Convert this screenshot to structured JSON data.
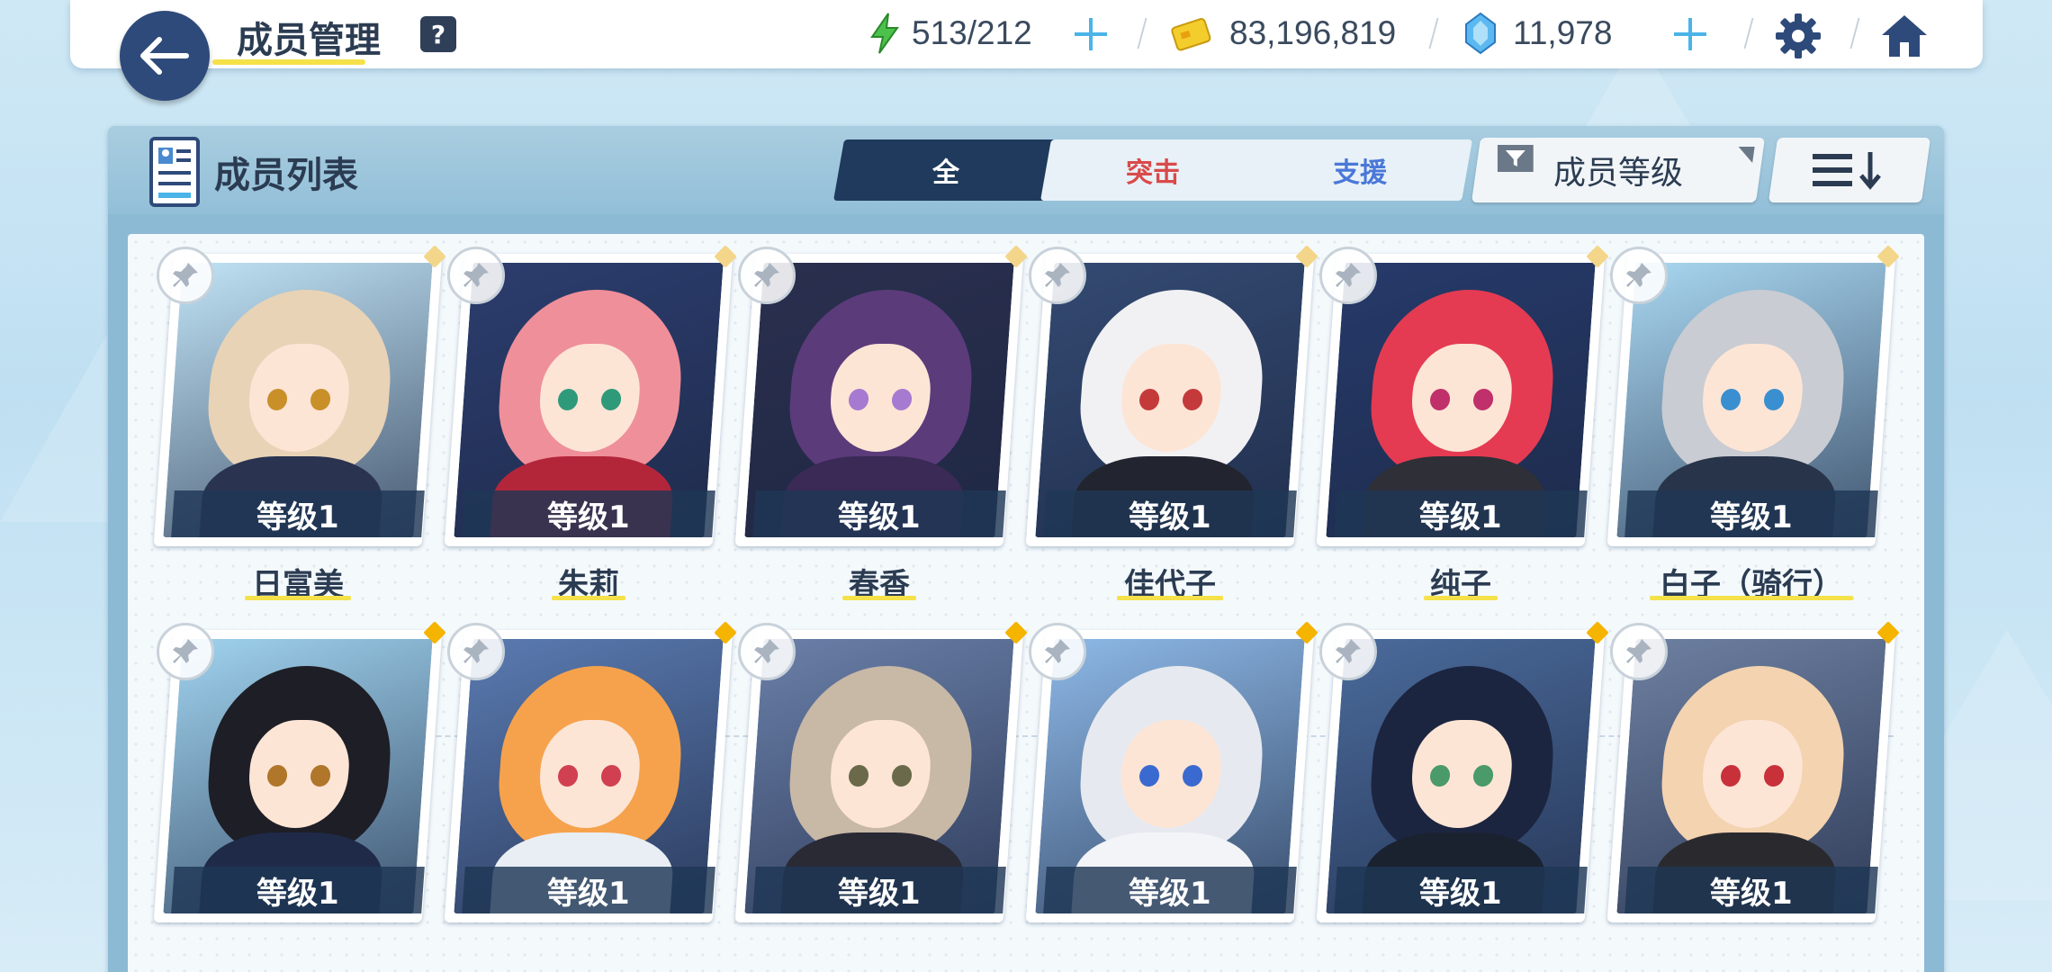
{
  "header": {
    "title": "成员管理",
    "help_label": "?",
    "stamina": "513/212",
    "credits": "83,196,819",
    "gems": "11,978"
  },
  "panel": {
    "title": "成员列表",
    "tabs": [
      {
        "label": "全",
        "active": true,
        "color": "#ffffff"
      },
      {
        "label": "突击",
        "active": false,
        "color": "#d94a4a"
      },
      {
        "label": "支援",
        "active": false,
        "color": "#4a78d8"
      }
    ],
    "sort_label": "成员等级"
  },
  "members": [
    {
      "name": "日富美",
      "level": "等级1",
      "hair": "#e8d3b6",
      "eye": "#c9902a",
      "bg": "#bfe2f4",
      "outfit": "#2a3350"
    },
    {
      "name": "朱莉",
      "level": "等级1",
      "hair": "#ef8f9a",
      "eye": "#2f9a7a",
      "bg": "#2c3d6e",
      "outfit": "#b3263a"
    },
    {
      "name": "春香",
      "level": "等级1",
      "hair": "#5b3b7a",
      "eye": "#a57ad0",
      "bg": "#2a2f4e",
      "outfit": "#3a2a55"
    },
    {
      "name": "佳代子",
      "level": "等级1",
      "hair": "#f1f1f4",
      "eye": "#c43a3a",
      "bg": "#344a72",
      "outfit": "#22252f"
    },
    {
      "name": "纯子",
      "level": "等级1",
      "hair": "#e43b52",
      "eye": "#c0306a",
      "bg": "#263a6a",
      "outfit": "#2f2f38"
    },
    {
      "name": "白子（骑行）",
      "level": "等级1",
      "hair": "#c9ccd2",
      "eye": "#3a8fd0",
      "bg": "#a8d6f0",
      "outfit": "#28344a"
    },
    {
      "name": "",
      "level": "等级1",
      "hair": "#1e1e26",
      "eye": "#b0762a",
      "bg": "#9fd2ee",
      "outfit": "#1e2a48"
    },
    {
      "name": "",
      "level": "等级1",
      "hair": "#f6a24c",
      "eye": "#d04050",
      "bg": "#5a7ab0",
      "outfit": "#e9eef5"
    },
    {
      "name": "",
      "level": "等级1",
      "hair": "#c8b8a6",
      "eye": "#6a6a4a",
      "bg": "#6a7fa8",
      "outfit": "#2a2a35"
    },
    {
      "name": "",
      "level": "等级1",
      "hair": "#e6e9ef",
      "eye": "#3a6ad0",
      "bg": "#8db8e6",
      "outfit": "#f2f4f8"
    },
    {
      "name": "",
      "level": "等级1",
      "hair": "#1c2540",
      "eye": "#4a9a6a",
      "bg": "#4a6a9a",
      "outfit": "#1a2230"
    },
    {
      "name": "",
      "level": "等级1",
      "hair": "#f3d3b0",
      "eye": "#c8303a",
      "bg": "#6d7fa0",
      "outfit": "#2a2a2e"
    }
  ]
}
